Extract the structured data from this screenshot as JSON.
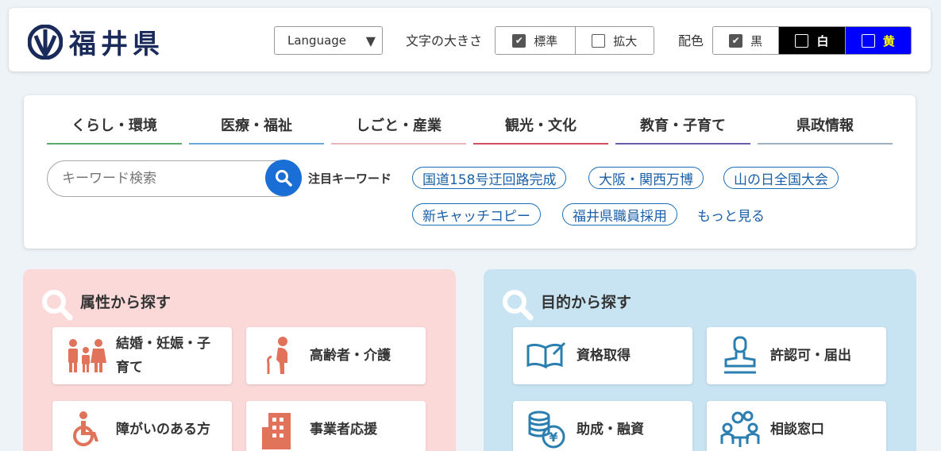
{
  "header": {
    "logo_text": "福井県",
    "language_label": "Language",
    "font_size_label": "文字の大きさ",
    "font_size_options": [
      {
        "label": "標準",
        "checked": true
      },
      {
        "label": "拡大",
        "checked": false
      }
    ],
    "color_label": "配色",
    "color_options": [
      {
        "label": "黒",
        "checked": true,
        "bg": "#ffffff",
        "fg": "#333333"
      },
      {
        "label": "白",
        "checked": false,
        "bg": "#000000",
        "fg": "#ffffff"
      },
      {
        "label": "黄",
        "checked": false,
        "bg": "#0000ff",
        "fg": "#ffff00"
      }
    ]
  },
  "nav": {
    "tabs": [
      {
        "label": "くらし・環境",
        "color": "#5aab6a"
      },
      {
        "label": "医療・福祉",
        "color": "#6aa8d8"
      },
      {
        "label": "しごと・産業",
        "color": "#e6b6bc"
      },
      {
        "label": "観光・文化",
        "color": "#d05060"
      },
      {
        "label": "教育・子育て",
        "color": "#6a5ab0"
      },
      {
        "label": "県政情報",
        "color": "#a0b0c0"
      }
    ],
    "search_placeholder": "キーワード検索",
    "keywords_label": "注目キーワード",
    "keywords": [
      "国道158号迂回路完成",
      "大阪・関西万博",
      "山の日全国大会",
      "新キャッチコピー",
      "福井県職員採用"
    ],
    "more_label": "もっと見る"
  },
  "panels": {
    "attribute": {
      "title": "属性から探す",
      "items": [
        {
          "label": "結婚・妊娠・子育て",
          "icon": "family-icon"
        },
        {
          "label": "高齢者・介護",
          "icon": "elderly-icon"
        },
        {
          "label": "障がいのある方",
          "icon": "wheelchair-icon"
        },
        {
          "label": "事業者応援",
          "icon": "building-icon"
        }
      ]
    },
    "purpose": {
      "title": "目的から探す",
      "items": [
        {
          "label": "資格取得",
          "icon": "book-icon"
        },
        {
          "label": "許認可・届出",
          "icon": "stamp-icon"
        },
        {
          "label": "助成・融資",
          "icon": "coins-icon"
        },
        {
          "label": "相談窓口",
          "icon": "consultation-icon"
        }
      ]
    }
  },
  "colors": {
    "accent": "#1a6fd6",
    "pink_panel": "#fbd9d9",
    "blue_panel": "#c8e4f2",
    "attr_icon": "#e0735a",
    "purpose_icon": "#2a7fb0"
  }
}
